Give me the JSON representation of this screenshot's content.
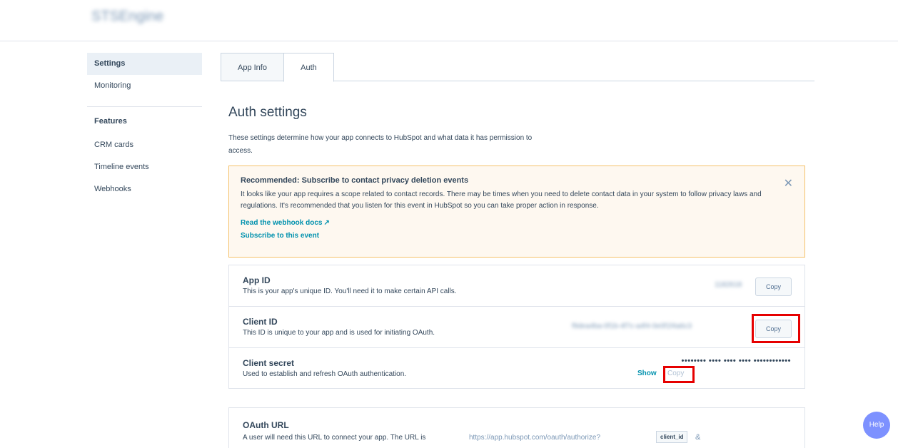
{
  "app": {
    "name": "STSEngine"
  },
  "sidebar": {
    "items": [
      {
        "label": "Settings"
      },
      {
        "label": "Monitoring"
      }
    ],
    "features_heading": "Features",
    "feature_items": [
      {
        "label": "CRM cards"
      },
      {
        "label": "Timeline events"
      },
      {
        "label": "Webhooks"
      }
    ]
  },
  "tabs": [
    {
      "label": "App Info"
    },
    {
      "label": "Auth",
      "active": true
    }
  ],
  "main": {
    "title": "Auth settings",
    "description": "These settings determine how your app connects to HubSpot and what data it has permission to access."
  },
  "alert": {
    "title": "Recommended: Subscribe to contact privacy deletion events",
    "body": "It looks like your app requires a scope related to contact records. There may be times when you need to delete contact data in your system to follow privacy laws and regulations. It's recommended that you listen for this event in HubSpot so you can take proper action in response.",
    "link1": "Read the webhook docs",
    "link2": "Subscribe to this event",
    "close_icon": "close-icon"
  },
  "credentials": {
    "app_id": {
      "title": "App ID",
      "desc": "This is your app's unique ID. You'll need it to make certain API calls.",
      "value": "1182618",
      "copy_label": "Copy"
    },
    "client_id": {
      "title": "Client ID",
      "desc": "This ID is unique to your app and is used for initiating OAuth.",
      "value": "f9dea4ba-0f1b-4f7c-a4f4-0e0f1f4a6c3",
      "copy_label": "Copy"
    },
    "client_secret": {
      "title": "Client secret",
      "desc": "Used to establish and refresh OAuth authentication.",
      "masked": "•••••••• •••• •••• •••• ••••••••••••",
      "show_label": "Show",
      "copy_label": "Copy"
    }
  },
  "oauth": {
    "title": "OAuth URL",
    "desc": "A user will need this URL to connect your app. The URL is",
    "url": "https://app.hubspot.com/oauth/authorize?",
    "param": "client_id",
    "amp": "&"
  },
  "help": {
    "label": "Help"
  },
  "colors": {
    "accent_link": "#0091ae",
    "alert_bg": "#fef8f0",
    "alert_border": "#f5c26b",
    "highlight": "#e60000",
    "help_bg": "#7d91ff"
  }
}
